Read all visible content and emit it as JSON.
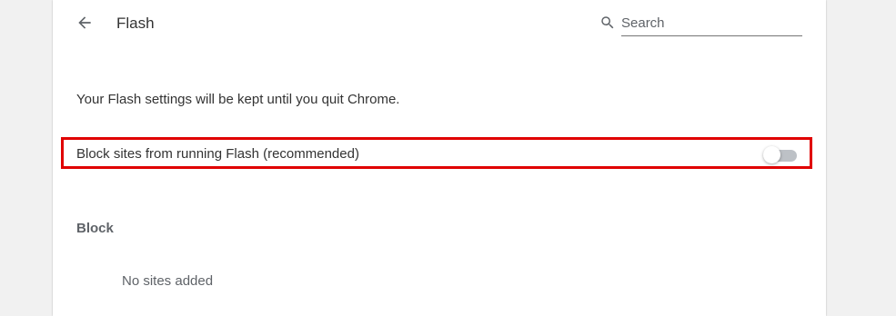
{
  "header": {
    "back_icon": "arrow-back-icon",
    "title": "Flash",
    "search": {
      "icon": "search-icon",
      "placeholder": "Search",
      "value": ""
    }
  },
  "content": {
    "info_text": "Your Flash settings will be kept until you quit Chrome.",
    "block_toggle": {
      "label": "Block sites from running Flash (recommended)",
      "checked": false,
      "highlight_color": "#e00000"
    },
    "block_section": {
      "heading": "Block",
      "empty_text": "No sites added"
    }
  },
  "colors": {
    "background": "#f1f1f1",
    "card": "#ffffff",
    "toggle_track_off": "#bdc1c6",
    "toggle_knob_off": "#ffffff"
  }
}
